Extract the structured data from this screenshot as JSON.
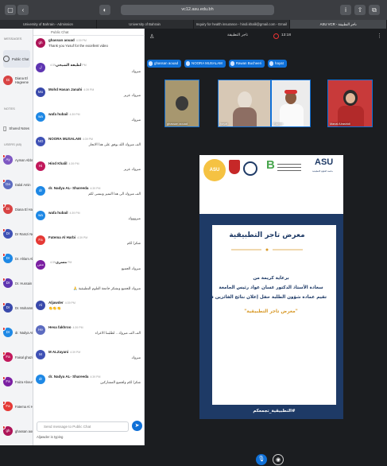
{
  "browser": {
    "url": "vc12.asu.edu.bh",
    "tabs": [
      "University of Bahrain - Admission",
      "University of Bahrain",
      "Inquiry for health insurance - hindi.khalil@gmail.com - Email",
      "ASU VCR - تاجر التطبيقة"
    ]
  },
  "sidebar": {
    "messages_heading": "MESSAGES",
    "public_chat": "Public Chat",
    "private_chat_user": "Diana El Hageene",
    "notes_heading": "NOTES",
    "shared_notes": "Shared Notes",
    "users_heading": "USERS (48)",
    "users": [
      {
        "initials": "Ay",
        "name": "Ayman Abbnour",
        "color": "#7e57c2"
      },
      {
        "initials": "Da",
        "name": "Dalal Amin",
        "color": "#5c6bc0"
      },
      {
        "initials": "Di",
        "name": "Diana El Hageene",
        "color": "#d84343"
      },
      {
        "initials": "Dr",
        "name": "Dr Ramzi Nekhili",
        "color": "#3f51b5"
      },
      {
        "initials": "Dr",
        "name": "Dr. Ahlam Alathawi",
        "color": "#1e88e5"
      },
      {
        "initials": "Dr",
        "name": "Dr. Hussain Bani Issa",
        "color": "#5e35b1"
      },
      {
        "initials": "Dr",
        "name": "Dr. Mohammed Yo...",
        "color": "#3949ab"
      },
      {
        "initials": "Dr",
        "name": "dr. Nadya AL- Shar...",
        "color": "#1e88e5"
      },
      {
        "initials": "Fa",
        "name": "Faisal ghazi",
        "color": "#c2185b"
      },
      {
        "initials": "Fa",
        "name": "Faiza Abouni",
        "color": "#7b1fa2"
      },
      {
        "initials": "Fa",
        "name": "Fatema Al Harbi",
        "color": "#e53935"
      },
      {
        "initials": "gh",
        "name": "ghassan aouad",
        "color": "#ad1457"
      }
    ]
  },
  "chat": {
    "header": "Public Chat",
    "placeholder": "Send message to Public Chat",
    "typing": "Aljawder is typing",
    "messages": [
      {
        "initials": "gh",
        "name": "ghassan aouad",
        "time": "4:39 PM",
        "text": "Thank you Yusuf for the excellent video",
        "color": "#ad1457"
      },
      {
        "initials": "ل",
        "name": "لطيفة الشيخي",
        "time": "4:39 PM",
        "text": "مبروك",
        "color": "#5e35b1"
      },
      {
        "initials": "Mo",
        "name": "Mohd Hasan Janahi",
        "time": "4:39 PM",
        "text": "مبروك عزيز",
        "color": "#3949ab"
      },
      {
        "initials": "wa",
        "name": "wafa hubail",
        "time": "4:39 PM",
        "text": "مبروك",
        "color": "#1e88e5"
      },
      {
        "initials": "NO",
        "name": "NOORA MUSALAM",
        "time": "4:39 PM",
        "text": "الف مبروك الله يوفق على هذا الانجاز",
        "color": "#3f51b5"
      },
      {
        "initials": "Hi",
        "name": "Hind Khalil",
        "time": "4:39 PM",
        "text": "مبروك عزيز",
        "color": "#c2185b"
      },
      {
        "initials": "dr",
        "name": "dr. Nadya AL- Shareeda",
        "time": "4:39 PM",
        "text": "الف مبروك الى هذا التميز ونتمنى لكم",
        "color": "#1e88e5"
      },
      {
        "initials": "wa",
        "name": "wafa hubail",
        "time": "4:39 PM",
        "text": "مبروووك",
        "color": "#1e88e5"
      },
      {
        "initials": "Fa",
        "name": "Fatema Al Harbi",
        "time": "4:39 PM",
        "text": "شكرا لكم",
        "color": "#e53935"
      },
      {
        "initials": "مس",
        "name": "مسرى",
        "time": "4:39 PM",
        "text": "مبروك الجميع",
        "color": "#7b1fa2"
      },
      {
        "initials": "",
        "name": "",
        "time": "",
        "text": "مبروك للجميع ونشكر جامعة العلوم التطبيقية 🙏",
        "color": "#1e88e5"
      },
      {
        "initials": "Al",
        "name": "Aljawder",
        "time": "4:39 PM",
        "text": "👏👏👏",
        "color": "#3949ab"
      },
      {
        "initials": "He",
        "name": "Hesa fakhroo",
        "time": "4:39 PM",
        "text": "الف الف مبروك .. لطلبتنا الاعزاء",
        "color": "#5c6bc0"
      },
      {
        "initials": "M",
        "name": "M ALZayani",
        "time": "4:39 PM",
        "text": "مبروك",
        "color": "#3f51b5"
      },
      {
        "initials": "dr",
        "name": "dr. Nadya AL- Shareeda",
        "time": "4:39 PM",
        "text": "شكرا لكم ولجميع المشاركين",
        "color": "#1e88e5"
      }
    ]
  },
  "stage": {
    "room_title": "تاجر التطبيقة",
    "rec_time": "13:18",
    "talkers": [
      "ghassan aouad",
      "NOORA MUSALAM",
      "Rawan Bucheeri",
      "hayat"
    ],
    "tiles": [
      {
        "label": "ghassan aouad",
        "bg": "#a7976f"
      },
      {
        "label": "hayat",
        "bg": "#d7c8b5"
      },
      {
        "label": "Rawan",
        "bg": "#ececec"
      },
      {
        "label": "Manal Alrashidi",
        "bg": "#c83a3a"
      }
    ],
    "slide": {
      "title": "معرض تاجر التطبيقية",
      "lines": [
        "برعاية كريمة من",
        "سعادة الأستاذ الدكتور غسان عواد رئيس الجامعة",
        "تقيم عمادة شؤون الطلبة حفل إعلان نتائج الفائزين في"
      ],
      "quote": "\"معرض تاجر التطبيقية\"",
      "footer": "#التطبيقية_تجمعكم",
      "asu_logo": "ASU",
      "asu_sub": "جامعة العلوم التطبيقية",
      "brand_b": "B"
    }
  }
}
